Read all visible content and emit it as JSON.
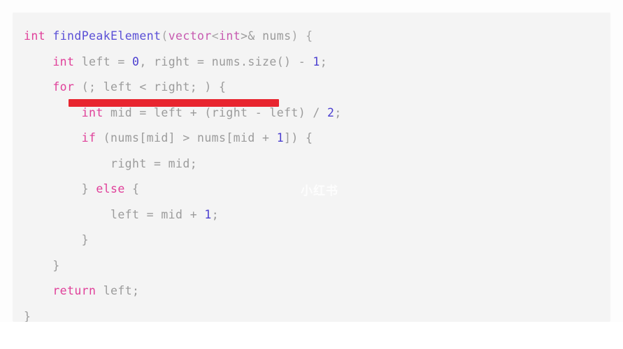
{
  "card": {
    "language": "cpp",
    "background_color": "#f4f4f4",
    "watermark_text": "小红书"
  },
  "colors": {
    "keyword": "#e0409a",
    "function": "#5a4fd6",
    "type": "#c75ab0",
    "number": "#4b3fd0",
    "plain": "#9b9b9b",
    "redaction": "#e8252f",
    "card_bg": "#f4f4f4",
    "page_bg": "#fdfdfd"
  },
  "annotation": {
    "redaction_bar_label": "red-highlight-bar"
  },
  "code": {
    "lines": [
      {
        "indent": 0,
        "tokens": [
          {
            "t": "int",
            "c": "kw"
          },
          {
            "t": " ",
            "c": "plain"
          },
          {
            "t": "findPeakElement",
            "c": "fn"
          },
          {
            "t": "(",
            "c": "punct"
          },
          {
            "t": "vector",
            "c": "type"
          },
          {
            "t": "<",
            "c": "punct"
          },
          {
            "t": "int",
            "c": "type"
          },
          {
            "t": ">& nums",
            "c": "plain"
          },
          {
            "t": ") {",
            "c": "punct"
          }
        ]
      },
      {
        "indent": 1,
        "tokens": [
          {
            "t": "int",
            "c": "kw"
          },
          {
            "t": " left = ",
            "c": "plain"
          },
          {
            "t": "0",
            "c": "num"
          },
          {
            "t": ", right = nums.size() - ",
            "c": "plain"
          },
          {
            "t": "1",
            "c": "num"
          },
          {
            "t": ";",
            "c": "plain"
          }
        ]
      },
      {
        "indent": 1,
        "tokens": [
          {
            "t": "for",
            "c": "kw"
          },
          {
            "t": " (; left < right; ) {",
            "c": "plain"
          }
        ]
      },
      {
        "indent": 2,
        "tokens": [
          {
            "t": "int",
            "c": "kw"
          },
          {
            "t": " mid = left + (right - left) / ",
            "c": "plain"
          },
          {
            "t": "2",
            "c": "num"
          },
          {
            "t": ";",
            "c": "plain"
          }
        ]
      },
      {
        "indent": 2,
        "tokens": [
          {
            "t": "if",
            "c": "kw"
          },
          {
            "t": " (nums[mid] > nums[mid + ",
            "c": "plain"
          },
          {
            "t": "1",
            "c": "num"
          },
          {
            "t": "]) {",
            "c": "plain"
          }
        ]
      },
      {
        "indent": 3,
        "tokens": [
          {
            "t": "right = mid;",
            "c": "plain"
          }
        ]
      },
      {
        "indent": 2,
        "tokens": [
          {
            "t": "} ",
            "c": "plain"
          },
          {
            "t": "else",
            "c": "kw"
          },
          {
            "t": " {",
            "c": "plain"
          }
        ]
      },
      {
        "indent": 3,
        "tokens": [
          {
            "t": "left = mid + ",
            "c": "plain"
          },
          {
            "t": "1",
            "c": "num"
          },
          {
            "t": ";",
            "c": "plain"
          }
        ]
      },
      {
        "indent": 2,
        "tokens": [
          {
            "t": "}",
            "c": "plain"
          }
        ]
      },
      {
        "indent": 1,
        "tokens": [
          {
            "t": "}",
            "c": "plain"
          }
        ]
      },
      {
        "indent": 1,
        "tokens": [
          {
            "t": "return",
            "c": "kw"
          },
          {
            "t": " left;",
            "c": "plain"
          }
        ]
      },
      {
        "indent": 0,
        "tokens": [
          {
            "t": "}",
            "c": "plain"
          }
        ]
      }
    ]
  }
}
